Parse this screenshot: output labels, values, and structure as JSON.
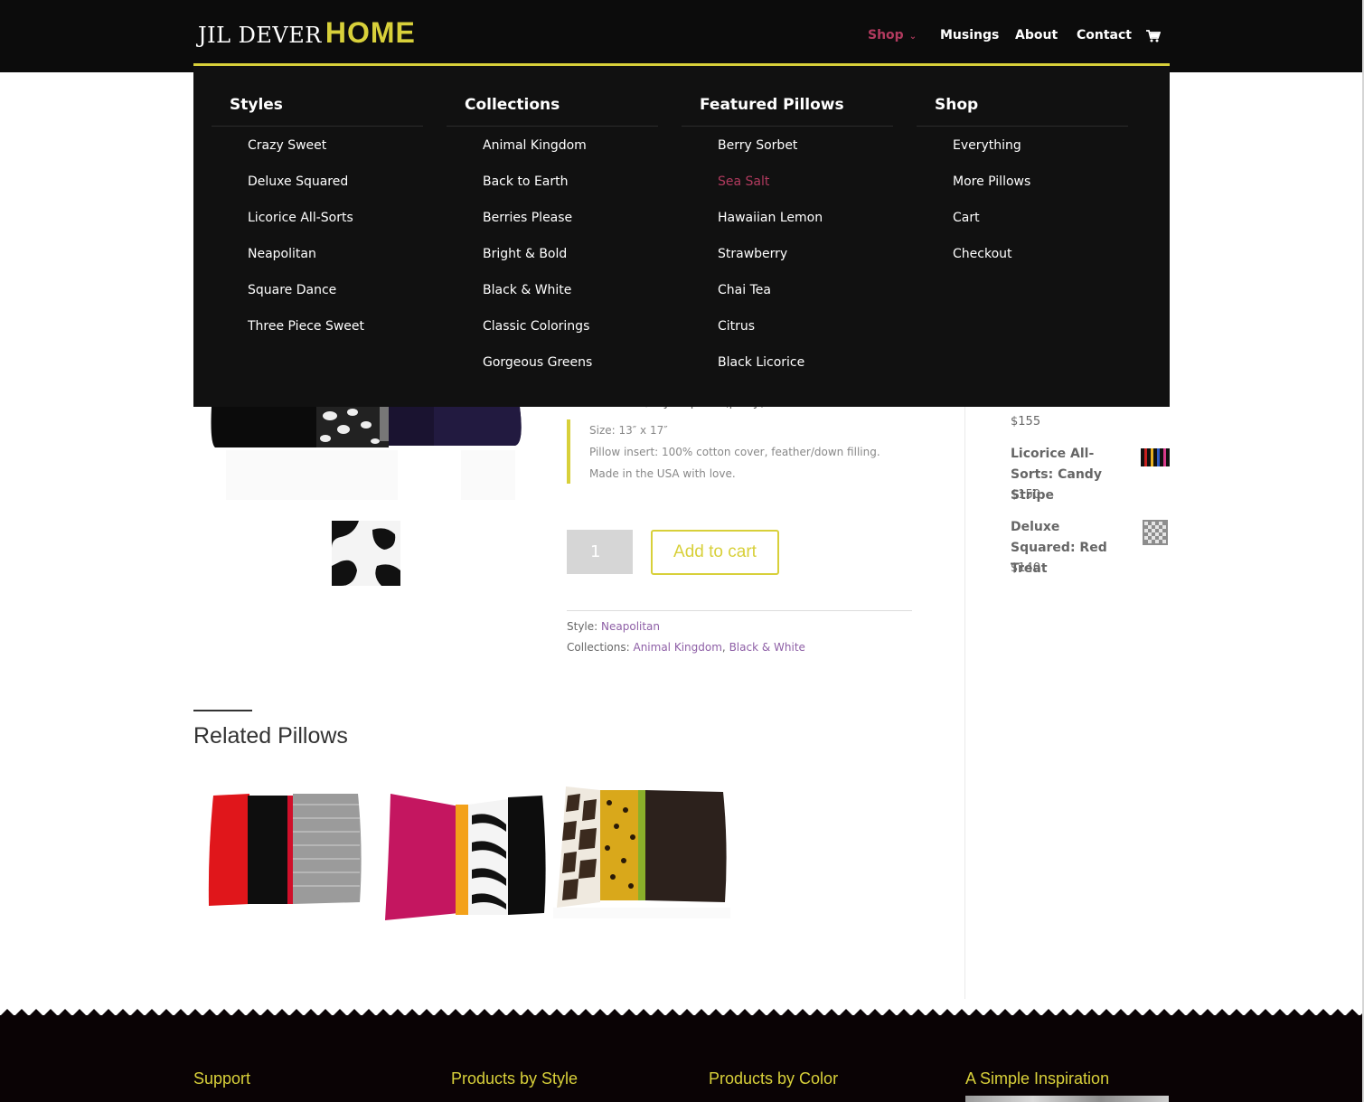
{
  "header": {
    "logo_part1": "JIL DEVER",
    "logo_part2": "HOME",
    "nav": {
      "shop": "Shop",
      "musings": "Musings",
      "about": "About",
      "contact": "Contact"
    },
    "colors": {
      "background": "#0c0c0c",
      "accent": "#d8d03a",
      "active": "#b13a5e"
    }
  },
  "mega_menu": {
    "styles": {
      "heading": "Styles",
      "items": [
        "Crazy Sweet",
        "Deluxe Squared",
        "Licorice All-Sorts",
        "Neapolitan",
        "Square Dance",
        "Three Piece Sweet"
      ]
    },
    "collections": {
      "heading": "Collections",
      "items": [
        "Animal Kingdom",
        "Back to Earth",
        "Berries Please",
        "Bright & Bold",
        "Black & White",
        "Classic Colorings",
        "Gorgeous Greens"
      ]
    },
    "featured": {
      "heading": "Featured Pillows",
      "items": [
        "Berry Sorbet",
        "Sea Salt",
        "Hawaiian Lemon",
        "Strawberry",
        "Chai Tea",
        "Citrus",
        "Black Licorice"
      ],
      "active_item": "Sea Salt"
    },
    "shop": {
      "heading": "Shop",
      "items": [
        "Everything",
        "More Pillows",
        "Cart",
        "Checkout"
      ]
    }
  },
  "product": {
    "description_fragment": "white cotton/rayon print (pony).",
    "specs": [
      "Size: 13″ x 17″",
      "Pillow insert: 100% cotton cover, feather/down filling.",
      "Made in the USA with love."
    ],
    "quantity": "1",
    "add_to_cart": "Add to cart",
    "style_label": "Style:",
    "style_value": "Neapolitan",
    "collections_label": "Collections:",
    "collections_values": [
      "Animal Kingdom",
      "Black & White"
    ],
    "collections_separator": ","
  },
  "related": {
    "title": "Related Pillows"
  },
  "sidebar": {
    "items": [
      {
        "title": "",
        "price": "$155"
      },
      {
        "title": "Licorice All-Sorts: Candy Stripe",
        "price": "$150"
      },
      {
        "title": "Deluxe Squared: Red Treat",
        "price": "$140"
      }
    ]
  },
  "footer": {
    "headings": [
      "Support",
      "Products by Style",
      "Products by Color",
      "A Simple Inspiration"
    ]
  }
}
